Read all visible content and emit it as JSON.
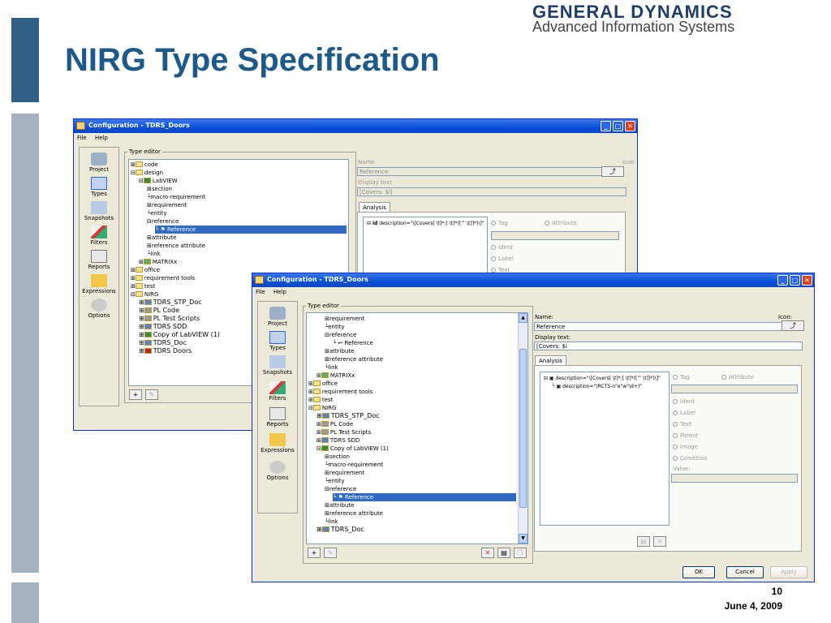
{
  "slide": {
    "title": "NIRG Type Specification",
    "logo_line1": "GENERAL DYNAMICS",
    "logo_line2": "Advanced Information Systems",
    "page_number": "10",
    "date": "June 4, 2009"
  },
  "back_window": {
    "title": "Configuration - TDRS_Doors",
    "menu": [
      "File",
      "Help"
    ],
    "nav": [
      "Project",
      "Types",
      "Snapshots",
      "Filters",
      "Reports",
      "Expressions",
      "Options"
    ],
    "group_label": "Type editor",
    "tree": [
      "code",
      "design",
      "LabVIEW",
      "section",
      "macro-requirement",
      "requirement",
      "entity",
      "reference",
      "Reference",
      "attribute",
      "reference attribute",
      "link",
      "MATRIXx",
      "office",
      "requirement tools",
      "test",
      "NIRG",
      "TDRS_STP_Doc",
      "PL Code",
      "PL Test Scripts",
      "TDRS SDD",
      "Copy of LabVIEW (1)",
      "TDRS_Doc",
      "TDRS Doors"
    ],
    "name_label": "Name",
    "name_value": "Reference",
    "icon_label": "Icon",
    "display_label": "Display text",
    "display_value": "[Covers: $i]",
    "tab": "Analysis",
    "analysis_item": "description=\"\\[Covers[ \\t]*:[ \\t]*([^ \\t]]*)\\]\"",
    "radios": [
      "Tag",
      "Attribute",
      "Ident",
      "Label",
      "Text"
    ]
  },
  "front_window": {
    "title": "Configuration - TDRS_Doors",
    "menu": [
      "File",
      "Help"
    ],
    "nav": [
      "Project",
      "Types",
      "Snapshots",
      "Filters",
      "Reports",
      "Expressions",
      "Options"
    ],
    "group_label": "Type editor",
    "tree": [
      "requirement",
      "entity",
      "reference",
      "Reference",
      "attribute",
      "reference attribute",
      "link",
      "MATRIXx",
      "office",
      "requirement tools",
      "test",
      "NIRG",
      "TDRS_STP_Doc",
      "PL Code",
      "PL Test Scripts",
      "TDRS SDD",
      "Copy of LabVIEW (1)",
      "section",
      "macro-requirement",
      "requirement",
      "entity",
      "reference",
      "Reference",
      "attribute",
      "reference attribute",
      "link",
      "TDRS_Doc"
    ],
    "name_label": "Name:",
    "name_value": "Reference",
    "icon_label": "Icon:",
    "display_label": "Display text:",
    "display_value": "[Covers: $i",
    "tab": "Analysis",
    "analysis_items": [
      "description=\"\\[Covers[ \\t]*:[ \\t]*([^ \\t]]*)\\]\"",
      "description=\"(RCTS-n\"e\"w\"\\d+)\""
    ],
    "radios": [
      "Tag",
      "Attribute",
      "Ident",
      "Label",
      "Text",
      "Parent",
      "Image",
      "Condition"
    ],
    "value_label": "Value:",
    "ok_label": "OK",
    "cancel_label": "Cancel",
    "apply_label": "Apply"
  },
  "colors": {
    "title_blue": "#1d5a8a",
    "xp_titlebar": "#0a4fd8",
    "selection": "#316ac5"
  }
}
